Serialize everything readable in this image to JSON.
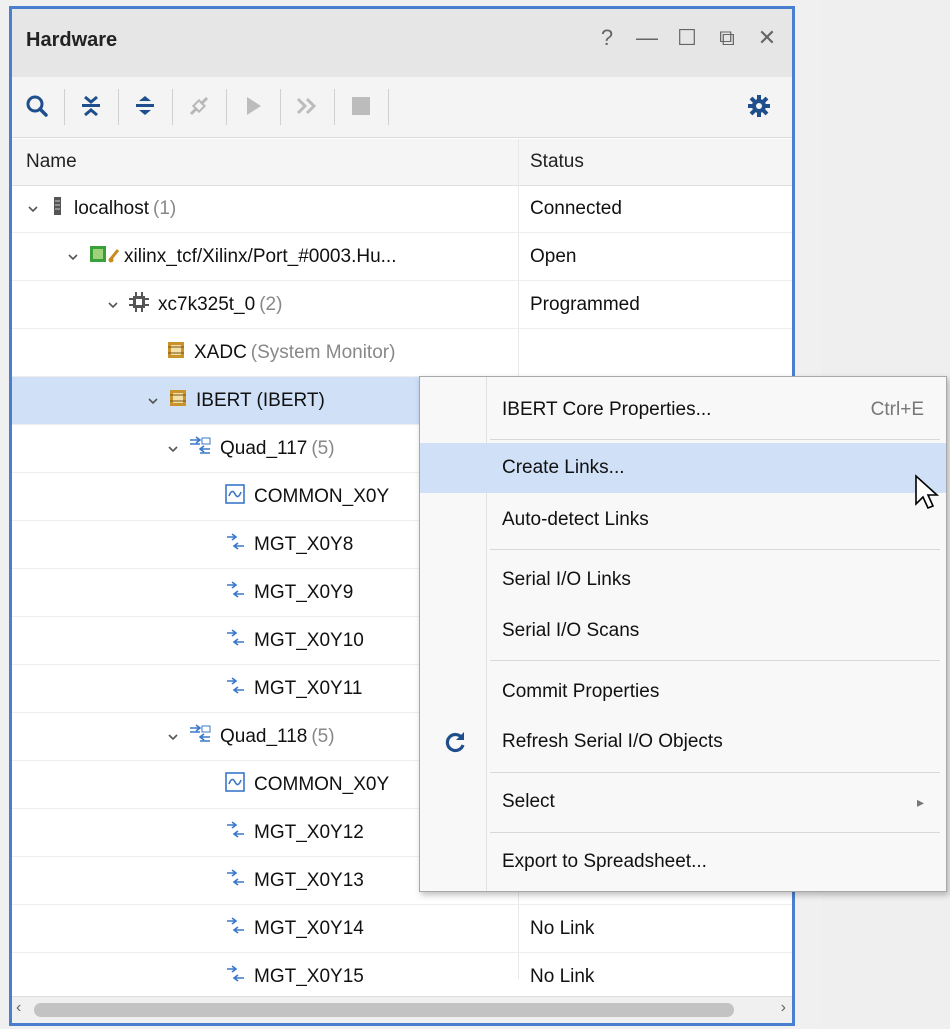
{
  "panel": {
    "title": "Hardware",
    "window_buttons": [
      "?",
      "—",
      "☐",
      "⧉",
      "✕"
    ],
    "columns": {
      "name": "Name",
      "status": "Status"
    }
  },
  "tree": [
    {
      "label": "localhost",
      "count": "(1)",
      "status": "Connected",
      "icon": "server-icon",
      "expanded": true
    },
    {
      "label": "xilinx_tcf/Xilinx/Port_#0003.Hu...",
      "count": "",
      "status": "Open",
      "icon": "jtag-cable-icon",
      "expanded": true
    },
    {
      "label": "xc7k325t_0",
      "count": "(2)",
      "status": "Programmed",
      "icon": "fpga-chip-icon",
      "expanded": true
    },
    {
      "label": "XADC",
      "count": "(System Monitor)",
      "status": "",
      "icon": "debug-core-icon",
      "expanded": null
    },
    {
      "label": "IBERT (IBERT)",
      "count": "",
      "status": "",
      "icon": "debug-core-icon",
      "expanded": true
    },
    {
      "label": "Quad_117",
      "count": "(5)",
      "status": "",
      "icon": "quad-icon",
      "expanded": true
    },
    {
      "label": "COMMON_X0Y",
      "count": "",
      "status": "",
      "icon": "common-icon",
      "expanded": null
    },
    {
      "label": "MGT_X0Y8",
      "count": "",
      "status": "",
      "icon": "mgt-icon",
      "expanded": null
    },
    {
      "label": "MGT_X0Y9",
      "count": "",
      "status": "",
      "icon": "mgt-icon",
      "expanded": null
    },
    {
      "label": "MGT_X0Y10",
      "count": "",
      "status": "",
      "icon": "mgt-icon",
      "expanded": null
    },
    {
      "label": "MGT_X0Y11",
      "count": "",
      "status": "",
      "icon": "mgt-icon",
      "expanded": null
    },
    {
      "label": "Quad_118",
      "count": "(5)",
      "status": "",
      "icon": "quad-icon",
      "expanded": true
    },
    {
      "label": "COMMON_X0Y",
      "count": "",
      "status": "",
      "icon": "common-icon",
      "expanded": null
    },
    {
      "label": "MGT_X0Y12",
      "count": "",
      "status": "",
      "icon": "mgt-icon",
      "expanded": null
    },
    {
      "label": "MGT_X0Y13",
      "count": "",
      "status": "",
      "icon": "mgt-icon",
      "expanded": null
    },
    {
      "label": "MGT_X0Y14",
      "count": "",
      "status": "No Link",
      "icon": "mgt-icon",
      "expanded": null
    },
    {
      "label": "MGT_X0Y15",
      "count": "",
      "status": "No Link",
      "icon": "mgt-icon",
      "expanded": null
    }
  ],
  "selected_row": "IBERT (IBERT)",
  "context_menu": {
    "items": [
      {
        "label": "IBERT Core Properties...",
        "shortcut": "Ctrl+E"
      },
      {
        "label": "Create Links...",
        "shortcut": ""
      },
      {
        "label": "Auto-detect Links",
        "shortcut": ""
      },
      {
        "label": "Serial I/O Links",
        "shortcut": ""
      },
      {
        "label": "Serial I/O Scans",
        "shortcut": ""
      },
      {
        "label": "Commit Properties",
        "shortcut": ""
      },
      {
        "label": "Refresh Serial I/O Objects",
        "shortcut": ""
      },
      {
        "label": "Select",
        "shortcut": "▸"
      },
      {
        "label": "Export to Spreadsheet...",
        "shortcut": ""
      }
    ],
    "hovered": "Create Links..."
  },
  "colors": {
    "accent_border": "#4a7fd0",
    "selection": "#cfe0f7",
    "chip_green": "#3aa13a",
    "link_blue": "#3a78c9"
  }
}
